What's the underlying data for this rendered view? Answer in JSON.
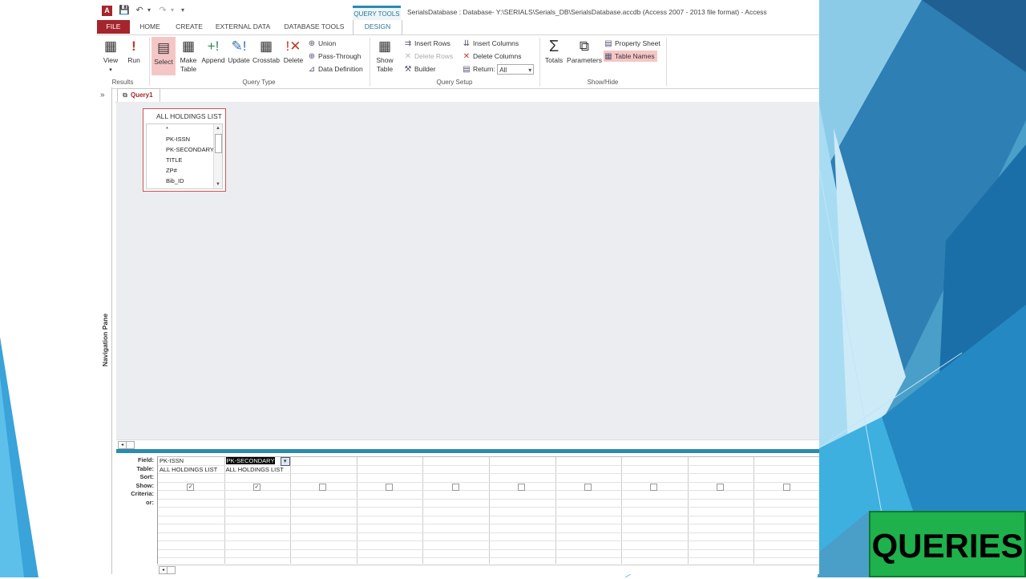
{
  "window": {
    "title": "SerialsDatabase : Database- Y:\\SERIALS\\Serials_DB\\SerialsDatabase.accdb (Access 2007 - 2013 file format) - Access",
    "context_tab": "QUERY TOOLS"
  },
  "qat": {
    "logo": "A",
    "save": "💾",
    "undo": "↶",
    "redo": "↷",
    "customize": "▾"
  },
  "tabs": [
    "FILE",
    "HOME",
    "CREATE",
    "EXTERNAL DATA",
    "DATABASE TOOLS",
    "DESIGN"
  ],
  "ribbon": {
    "results": {
      "label": "Results",
      "view": "View",
      "run": "Run"
    },
    "query_type": {
      "label": "Query Type",
      "select": "Select",
      "make_table_1": "Make",
      "make_table_2": "Table",
      "append": "Append",
      "update": "Update",
      "crosstab": "Crosstab",
      "delete": "Delete",
      "union": "Union",
      "pass_through": "Pass-Through",
      "data_definition": "Data Definition"
    },
    "query_setup": {
      "label": "Query Setup",
      "show_table_1": "Show",
      "show_table_2": "Table",
      "insert_rows": "Insert Rows",
      "delete_rows": "Delete Rows",
      "builder": "Builder",
      "insert_columns": "Insert Columns",
      "delete_columns": "Delete Columns",
      "return_label": "Return:",
      "return_value": "All"
    },
    "show_hide": {
      "label": "Show/Hide",
      "totals": "Totals",
      "parameters": "Parameters",
      "property_sheet": "Property Sheet",
      "table_names": "Table Names"
    }
  },
  "nav_pane": {
    "label": "Navigation Pane",
    "toggle": "»"
  },
  "document_tab": "Query1",
  "table_box": {
    "title": "ALL HOLDINGS LIST",
    "fields": [
      "*",
      "PK-ISSN",
      "PK-SECONDARY",
      "TITLE",
      "ZP#",
      "Bib_ID"
    ]
  },
  "qbe": {
    "row_labels": [
      "Field:",
      "Table:",
      "Sort:",
      "Show:",
      "Criteria:",
      "or:"
    ],
    "columns": [
      {
        "field": "PK-ISSN",
        "table": "ALL HOLDINGS LIST",
        "show": true
      },
      {
        "field": "PK-SECONDARY",
        "table": "ALL HOLDINGS LIST",
        "show": true
      },
      {
        "field": "",
        "table": "",
        "show": false
      },
      {
        "field": "",
        "table": "",
        "show": false
      },
      {
        "field": "",
        "table": "",
        "show": false
      },
      {
        "field": "",
        "table": "",
        "show": false
      },
      {
        "field": "",
        "table": "",
        "show": false
      },
      {
        "field": "",
        "table": "",
        "show": false
      },
      {
        "field": "",
        "table": "",
        "show": false
      },
      {
        "field": "",
        "table": "",
        "show": false
      }
    ]
  },
  "badge": {
    "text": "QUERIES"
  },
  "colors": {
    "file_tab": "#a4262c",
    "accent": "#2b8bb0",
    "selected": "#f5c6c6",
    "badge": "#1fb14c"
  }
}
